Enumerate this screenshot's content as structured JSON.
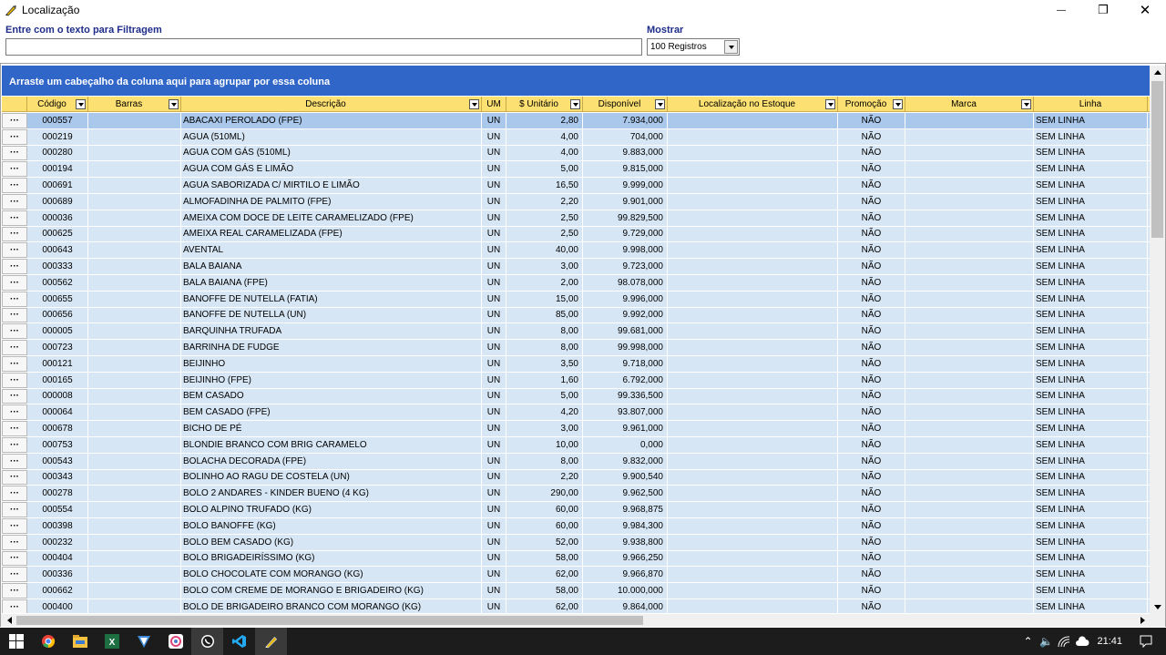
{
  "window": {
    "title": "Localização",
    "minimize": "—",
    "restore": "❐",
    "close": "✕"
  },
  "filter": {
    "label": "Entre com o texto para Filtragem",
    "value": ""
  },
  "show": {
    "label": "Mostrar",
    "selected": "100 Registros"
  },
  "group_panel": "Arraste um cabeçalho da coluna aqui para agrupar por essa coluna",
  "row_button": "···",
  "columns": [
    {
      "key": "btn",
      "label": ""
    },
    {
      "key": "codigo",
      "label": "Código",
      "filter": true
    },
    {
      "key": "barras",
      "label": "Barras",
      "filter": true
    },
    {
      "key": "descricao",
      "label": "Descrição",
      "filter": true
    },
    {
      "key": "um",
      "label": "UM"
    },
    {
      "key": "unitario",
      "label": "$ Unitário",
      "filter": true
    },
    {
      "key": "disponivel",
      "label": "Disponível",
      "filter": true
    },
    {
      "key": "localizacao",
      "label": "Localização no Estoque",
      "filter": true
    },
    {
      "key": "promocao",
      "label": "Promoção",
      "filter": true
    },
    {
      "key": "marca",
      "label": "Marca",
      "filter": true
    },
    {
      "key": "linha",
      "label": "Linha"
    }
  ],
  "rows": [
    [
      "000557",
      "",
      "ABACAXI PEROLADO (FPE)",
      "UN",
      "2,80",
      "7.934,000",
      "",
      "NÃO",
      "",
      "SEM LINHA"
    ],
    [
      "000219",
      "",
      "AGUA (510ML)",
      "UN",
      "4,00",
      "704,000",
      "",
      "NÃO",
      "",
      "SEM LINHA"
    ],
    [
      "000280",
      "",
      "AGUA COM GÁS (510ML)",
      "UN",
      "4,00",
      "9.883,000",
      "",
      "NÃO",
      "",
      "SEM LINHA"
    ],
    [
      "000194",
      "",
      "AGUA COM GÁS E LIMÃO",
      "UN",
      "5,00",
      "9.815,000",
      "",
      "NÃO",
      "",
      "SEM LINHA"
    ],
    [
      "000691",
      "",
      "AGUA SABORIZADA C/ MIRTILO E LIMÃO",
      "UN",
      "16,50",
      "9.999,000",
      "",
      "NÃO",
      "",
      "SEM LINHA"
    ],
    [
      "000689",
      "",
      "ALMOFADINHA DE PALMITO (FPE)",
      "UN",
      "2,20",
      "9.901,000",
      "",
      "NÃO",
      "",
      "SEM LINHA"
    ],
    [
      "000036",
      "",
      "AMEIXA COM DOCE DE LEITE CARAMELIZADO (FPE)",
      "UN",
      "2,50",
      "99.829,500",
      "",
      "NÃO",
      "",
      "SEM LINHA"
    ],
    [
      "000625",
      "",
      "AMEIXA REAL CARAMELIZADA (FPE)",
      "UN",
      "2,50",
      "9.729,000",
      "",
      "NÃO",
      "",
      "SEM LINHA"
    ],
    [
      "000643",
      "",
      "AVENTAL",
      "UN",
      "40,00",
      "9.998,000",
      "",
      "NÃO",
      "",
      "SEM LINHA"
    ],
    [
      "000333",
      "",
      "BALA BAIANA",
      "UN",
      "3,00",
      "9.723,000",
      "",
      "NÃO",
      "",
      "SEM LINHA"
    ],
    [
      "000562",
      "",
      "BALA BAIANA (FPE)",
      "UN",
      "2,00",
      "98.078,000",
      "",
      "NÃO",
      "",
      "SEM LINHA"
    ],
    [
      "000655",
      "",
      "BANOFFE DE NUTELLA (FATIA)",
      "UN",
      "15,00",
      "9.996,000",
      "",
      "NÃO",
      "",
      "SEM LINHA"
    ],
    [
      "000656",
      "",
      "BANOFFE DE NUTELLA (UN)",
      "UN",
      "85,00",
      "9.992,000",
      "",
      "NÃO",
      "",
      "SEM LINHA"
    ],
    [
      "000005",
      "",
      "BARQUINHA TRUFADA",
      "UN",
      "8,00",
      "99.681,000",
      "",
      "NÃO",
      "",
      "SEM LINHA"
    ],
    [
      "000723",
      "",
      "BARRINHA DE FUDGE",
      "UN",
      "8,00",
      "99.998,000",
      "",
      "NÃO",
      "",
      "SEM LINHA"
    ],
    [
      "000121",
      "",
      "BEIJINHO",
      "UN",
      "3,50",
      "9.718,000",
      "",
      "NÃO",
      "",
      "SEM LINHA"
    ],
    [
      "000165",
      "",
      "BEIJINHO (FPE)",
      "UN",
      "1,60",
      "6.792,000",
      "",
      "NÃO",
      "",
      "SEM LINHA"
    ],
    [
      "000008",
      "",
      "BEM CASADO",
      "UN",
      "5,00",
      "99.336,500",
      "",
      "NÃO",
      "",
      "SEM LINHA"
    ],
    [
      "000064",
      "",
      "BEM CASADO (FPE)",
      "UN",
      "4,20",
      "93.807,000",
      "",
      "NÃO",
      "",
      "SEM LINHA"
    ],
    [
      "000678",
      "",
      "BICHO DE PÉ",
      "UN",
      "3,00",
      "9.961,000",
      "",
      "NÃO",
      "",
      "SEM LINHA"
    ],
    [
      "000753",
      "",
      "BLONDIE BRANCO COM BRIG CARAMELO",
      "UN",
      "10,00",
      "0,000",
      "",
      "NÃO",
      "",
      "SEM LINHA"
    ],
    [
      "000543",
      "",
      "BOLACHA DECORADA (FPE)",
      "UN",
      "8,00",
      "9.832,000",
      "",
      "NÃO",
      "",
      "SEM LINHA"
    ],
    [
      "000343",
      "",
      "BOLINHO AO RAGU DE COSTELA (UN)",
      "UN",
      "2,20",
      "9.900,540",
      "",
      "NÃO",
      "",
      "SEM LINHA"
    ],
    [
      "000278",
      "",
      "BOLO 2 ANDARES - KINDER BUENO (4 KG)",
      "UN",
      "290,00",
      "9.962,500",
      "",
      "NÃO",
      "",
      "SEM LINHA"
    ],
    [
      "000554",
      "",
      "BOLO ALPINO TRUFADO (KG)",
      "UN",
      "60,00",
      "9.968,875",
      "",
      "NÃO",
      "",
      "SEM LINHA"
    ],
    [
      "000398",
      "",
      "BOLO BANOFFE (KG)",
      "UN",
      "60,00",
      "9.984,300",
      "",
      "NÃO",
      "",
      "SEM LINHA"
    ],
    [
      "000232",
      "",
      "BOLO BEM CASADO (KG)",
      "UN",
      "52,00",
      "9.938,800",
      "",
      "NÃO",
      "",
      "SEM LINHA"
    ],
    [
      "000404",
      "",
      "BOLO BRIGADEIRÍSSIMO (KG)",
      "UN",
      "58,00",
      "9.966,250",
      "",
      "NÃO",
      "",
      "SEM LINHA"
    ],
    [
      "000336",
      "",
      "BOLO CHOCOLATE COM MORANGO (KG)",
      "UN",
      "62,00",
      "9.966,870",
      "",
      "NÃO",
      "",
      "SEM LINHA"
    ],
    [
      "000662",
      "",
      "BOLO COM CREME DE MORANGO E BRIGADEIRO (KG)",
      "UN",
      "58,00",
      "10.000,000",
      "",
      "NÃO",
      "",
      "SEM LINHA"
    ],
    [
      "000400",
      "",
      "BOLO DE BRIGADEIRO BRANCO COM MORANGO (KG)",
      "UN",
      "62,00",
      "9.864,000",
      "",
      "NÃO",
      "",
      "SEM LINHA"
    ]
  ],
  "taskbar": {
    "apps": [
      "windows-start-icon",
      "chrome-icon",
      "file-explorer-icon",
      "excel-icon",
      "app-blue-icon",
      "app-pink-icon",
      "whatsapp-icon",
      "vscode-icon",
      "localizacao-app-icon"
    ],
    "time": "21:41"
  },
  "colors": {
    "group_panel": "#3166c9",
    "header": "#fce071",
    "row": "#d7e6f4",
    "row_selected": "#a9c8ec",
    "label": "#1e2d8a"
  }
}
